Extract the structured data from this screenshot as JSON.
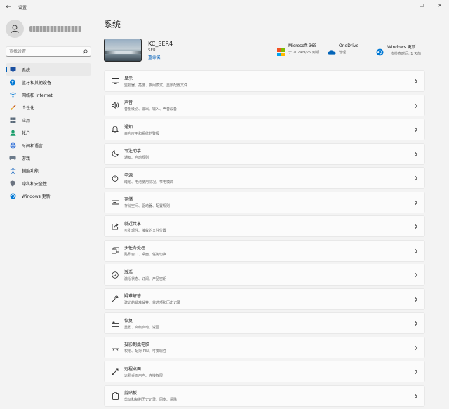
{
  "window": {
    "title": "设置",
    "back_glyph": "←",
    "minimize_glyph": "—",
    "maximize_glyph": "☐",
    "close_glyph": "✕"
  },
  "search": {
    "placeholder": "查找设置"
  },
  "sidebar": {
    "items": [
      {
        "label": "系统",
        "icon": "system-icon",
        "active": true
      },
      {
        "label": "蓝牙和其他设备",
        "icon": "bluetooth-icon"
      },
      {
        "label": "网络和 Internet",
        "icon": "wifi-icon"
      },
      {
        "label": "个性化",
        "icon": "brush-icon"
      },
      {
        "label": "应用",
        "icon": "apps-icon"
      },
      {
        "label": "帐户",
        "icon": "account-icon"
      },
      {
        "label": "时间和语言",
        "icon": "globe-clock-icon"
      },
      {
        "label": "游戏",
        "icon": "gamepad-icon"
      },
      {
        "label": "辅助功能",
        "icon": "accessibility-icon"
      },
      {
        "label": "隐私和安全性",
        "icon": "shield-icon"
      },
      {
        "label": "Windows 更新",
        "icon": "update-icon"
      }
    ]
  },
  "main": {
    "title": "系统",
    "device": {
      "name": "KC_SER4",
      "model": "SER",
      "rename": "重命名"
    },
    "quick": [
      {
        "title": "Microsoft 365",
        "sub": "于 2024/9/25 到期",
        "icon": "microsoft-logo-icon"
      },
      {
        "title": "OneDrive",
        "sub": "管理",
        "icon": "cloud-icon"
      },
      {
        "title": "Windows 更新",
        "sub": "上次检查时间: 1 天前",
        "icon": "update-icon"
      }
    ],
    "rows": [
      {
        "title": "显示",
        "desc": "监视器、亮度、夜间模式、显示配置文件",
        "icon": "display-icon"
      },
      {
        "title": "声音",
        "desc": "音量级别、输出、输入、声音设备",
        "icon": "speaker-icon"
      },
      {
        "title": "通知",
        "desc": "来自应用和系统的警报",
        "icon": "bell-icon"
      },
      {
        "title": "专注助手",
        "desc": "通知、自动规则",
        "icon": "moon-icon"
      },
      {
        "title": "电源",
        "desc": "睡眠、电池使用情况、节电模式",
        "icon": "power-icon"
      },
      {
        "title": "存储",
        "desc": "存储空间、驱动器、配置规则",
        "icon": "storage-icon"
      },
      {
        "title": "就近共享",
        "desc": "可发现性、接收的文件位置",
        "icon": "share-icon"
      },
      {
        "title": "多任务处理",
        "desc": "贴靠窗口、桌面、任务切换",
        "icon": "multitask-icon"
      },
      {
        "title": "激活",
        "desc": "激活状态、订阅、产品密钥",
        "icon": "check-circle-icon"
      },
      {
        "title": "疑难解答",
        "desc": "建议的疑难解答、首选项和历史记录",
        "icon": "wrench-icon"
      },
      {
        "title": "恢复",
        "desc": "重置、高级启动、返回",
        "icon": "recovery-icon"
      },
      {
        "title": "投影到此电脑",
        "desc": "权限、配对 PIN、可发现性",
        "icon": "project-icon"
      },
      {
        "title": "远程桌面",
        "desc": "远程桌面用户、连接权限",
        "icon": "remote-icon"
      },
      {
        "title": "剪贴板",
        "desc": "剪切和复制历史记录、同步、清除",
        "icon": "clipboard-icon"
      }
    ]
  },
  "colors": {
    "accent": "#005fb8",
    "background": "#f3f3f3",
    "card": "#fbfbfb"
  }
}
